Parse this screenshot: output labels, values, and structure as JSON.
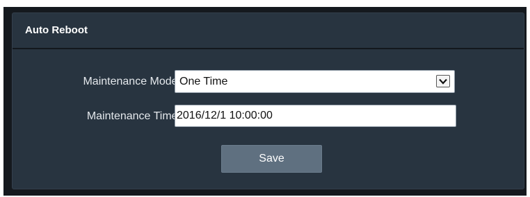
{
  "panel": {
    "title": "Auto Reboot"
  },
  "form": {
    "maintenance_mode": {
      "label": "Maintenance Mode:",
      "selected_value": "One Time",
      "options": [
        "One Time"
      ],
      "dropdown_icon": "chevron-down-icon"
    },
    "maintenance_time": {
      "label": "Maintenance Time:",
      "value": "2016/12/1 10:00:00"
    },
    "save_label": "Save"
  },
  "colors": {
    "frame_background": "#15191e",
    "panel_background": "#283440",
    "button_background": "#5f7080",
    "label_text": "#e4e8ec"
  }
}
